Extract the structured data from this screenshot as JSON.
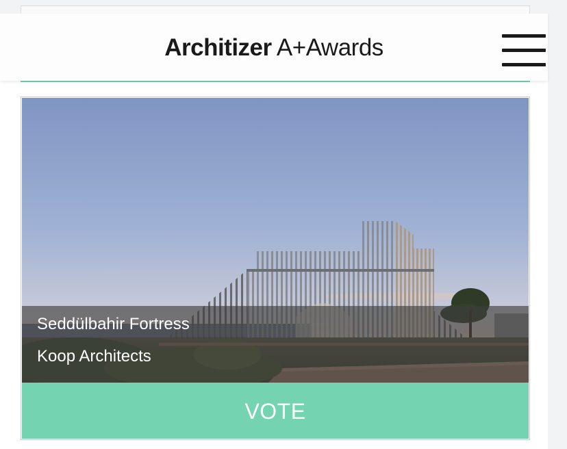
{
  "header": {
    "logo_brand": "Architizer",
    "logo_awards": " A+Awards"
  },
  "project": {
    "title": "Seddülbahir Fortress",
    "firm": "Koop Architects",
    "vote_label": "VOTE"
  },
  "colors": {
    "accent": "#74d3b1",
    "header_bg": "#fdfdfd",
    "logo_text": "#1a1a1a",
    "caption_overlay": "rgba(60,60,60,0.62)"
  },
  "icons": {
    "menu": "hamburger-icon"
  }
}
